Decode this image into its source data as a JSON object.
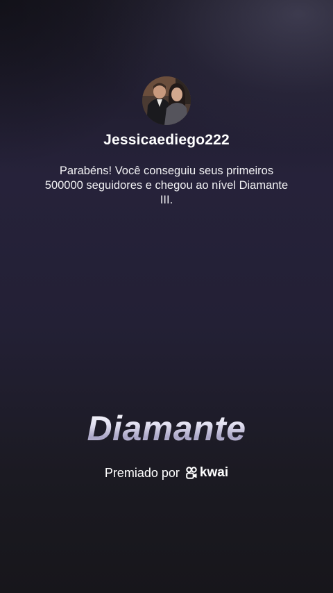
{
  "profile": {
    "username": "Jessicaediego222"
  },
  "message": "Parabéns! Você conseguiu seus primeiros 500000 seguidores e chegou ao nível Diamante III.",
  "level": {
    "title": "Diamante"
  },
  "footer": {
    "awarded_by": "Premiado por",
    "brand_name": "kwai",
    "brand_icon": "kwai-logo-icon"
  },
  "colors": {
    "background_top": "#1c1a26",
    "background_bottom": "#17161b",
    "level_title": "#d9d6ea",
    "text": "#ffffff"
  }
}
